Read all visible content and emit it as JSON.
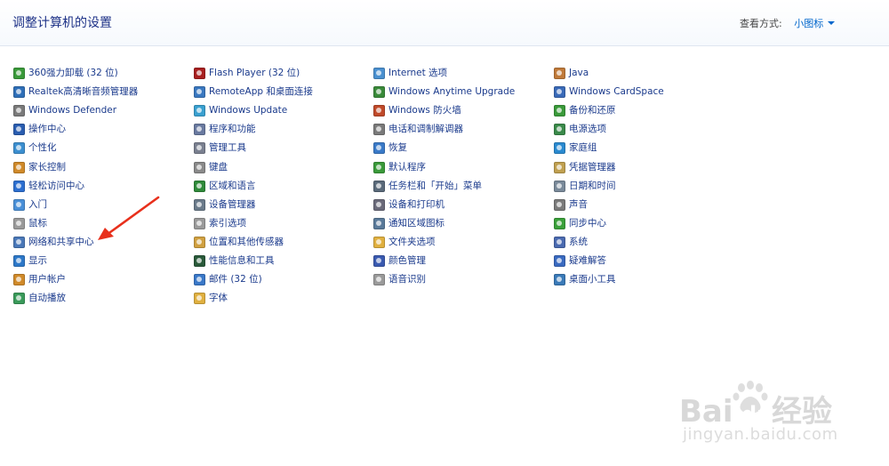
{
  "header": {
    "title": "调整计算机的设置",
    "view_by_label": "查看方式:",
    "view_by_value": "小图标"
  },
  "columns": [
    [
      {
        "label": "360强力卸载 (32 位)",
        "icon": "uninstall-icon",
        "color": "#3a9a3a"
      },
      {
        "label": "Realtek高清晰音频管理器",
        "icon": "audio-manager-icon",
        "color": "#2f6fb8"
      },
      {
        "label": "Windows Defender",
        "icon": "defender-icon",
        "color": "#7a7a7a"
      },
      {
        "label": "操作中心",
        "icon": "action-center-flag-icon",
        "color": "#2a5db0"
      },
      {
        "label": "个性化",
        "icon": "personalization-icon",
        "color": "#3c8fd0"
      },
      {
        "label": "家长控制",
        "icon": "parental-controls-icon",
        "color": "#d08a2a"
      },
      {
        "label": "轻松访问中心",
        "icon": "ease-of-access-icon",
        "color": "#2d6fd0"
      },
      {
        "label": "入门",
        "icon": "getting-started-icon",
        "color": "#4a90d8"
      },
      {
        "label": "鼠标",
        "icon": "mouse-icon",
        "color": "#9a9a9a"
      },
      {
        "label": "网络和共享中心",
        "icon": "network-sharing-icon",
        "color": "#4a78b8"
      },
      {
        "label": "显示",
        "icon": "display-icon",
        "color": "#2d78c8"
      },
      {
        "label": "用户帐户",
        "icon": "user-accounts-icon",
        "color": "#d08a2a"
      },
      {
        "label": "自动播放",
        "icon": "autoplay-icon",
        "color": "#3a9a5a"
      }
    ],
    [
      {
        "label": "Flash Player (32 位)",
        "icon": "flash-player-icon",
        "color": "#a82020"
      },
      {
        "label": "RemoteApp 和桌面连接",
        "icon": "remoteapp-icon",
        "color": "#3a78c0"
      },
      {
        "label": "Windows Update",
        "icon": "windows-update-icon",
        "color": "#3aa0d0"
      },
      {
        "label": "程序和功能",
        "icon": "programs-features-icon",
        "color": "#6a7aa0"
      },
      {
        "label": "管理工具",
        "icon": "admin-tools-icon",
        "color": "#7a8090"
      },
      {
        "label": "键盘",
        "icon": "keyboard-icon",
        "color": "#8a8a8a"
      },
      {
        "label": "区域和语言",
        "icon": "region-language-icon",
        "color": "#2f8a3a"
      },
      {
        "label": "设备管理器",
        "icon": "device-manager-icon",
        "color": "#6a7a8a"
      },
      {
        "label": "索引选项",
        "icon": "indexing-options-icon",
        "color": "#9a9a9a"
      },
      {
        "label": "位置和其他传感器",
        "icon": "location-sensors-icon",
        "color": "#d0a040"
      },
      {
        "label": "性能信息和工具",
        "icon": "performance-icon",
        "color": "#2a5a3a"
      },
      {
        "label": "邮件 (32 位)",
        "icon": "mail-icon",
        "color": "#3a78c8"
      },
      {
        "label": "字体",
        "icon": "fonts-folder-icon",
        "color": "#e0b040"
      }
    ],
    [
      {
        "label": "Internet 选项",
        "icon": "internet-options-icon",
        "color": "#4a90d0"
      },
      {
        "label": "Windows Anytime Upgrade",
        "icon": "anytime-upgrade-icon",
        "color": "#3a8a3a"
      },
      {
        "label": "Windows 防火墙",
        "icon": "firewall-icon",
        "color": "#c04a2a"
      },
      {
        "label": "电话和调制解调器",
        "icon": "phone-modem-icon",
        "color": "#7a7a7a"
      },
      {
        "label": "恢复",
        "icon": "recovery-icon",
        "color": "#3a7ac8"
      },
      {
        "label": "默认程序",
        "icon": "default-programs-icon",
        "color": "#3a9a3a"
      },
      {
        "label": "任务栏和「开始」菜单",
        "icon": "taskbar-start-icon",
        "color": "#5a6a7a"
      },
      {
        "label": "设备和打印机",
        "icon": "devices-printers-icon",
        "color": "#6a6a7a"
      },
      {
        "label": "通知区域图标",
        "icon": "notification-area-icon",
        "color": "#5a7a9a"
      },
      {
        "label": "文件夹选项",
        "icon": "folder-options-icon",
        "color": "#e0b040"
      },
      {
        "label": "颜色管理",
        "icon": "color-management-icon",
        "color": "#3a5ab0"
      },
      {
        "label": "语音识别",
        "icon": "speech-recognition-icon",
        "color": "#9a9a9a"
      }
    ],
    [
      {
        "label": "Java",
        "icon": "java-icon",
        "color": "#c07a3a"
      },
      {
        "label": "Windows CardSpace",
        "icon": "cardspace-icon",
        "color": "#3a6ab8"
      },
      {
        "label": "备份和还原",
        "icon": "backup-restore-icon",
        "color": "#3a9a3a"
      },
      {
        "label": "电源选项",
        "icon": "power-options-icon",
        "color": "#3a8a4a"
      },
      {
        "label": "家庭组",
        "icon": "homegroup-icon",
        "color": "#2a8ad0"
      },
      {
        "label": "凭据管理器",
        "icon": "credential-manager-icon",
        "color": "#c0a050"
      },
      {
        "label": "日期和时间",
        "icon": "date-time-icon",
        "color": "#7a8a9a"
      },
      {
        "label": "声音",
        "icon": "sound-icon",
        "color": "#7a7a7a"
      },
      {
        "label": "同步中心",
        "icon": "sync-center-icon",
        "color": "#3aa03a"
      },
      {
        "label": "系统",
        "icon": "system-icon",
        "color": "#4a6ab0"
      },
      {
        "label": "疑难解答",
        "icon": "troubleshooting-icon",
        "color": "#3a6ac0"
      },
      {
        "label": "桌面小工具",
        "icon": "desktop-gadgets-icon",
        "color": "#3a7ab8"
      }
    ]
  ],
  "annotation": {
    "arrow_color": "#e8301c",
    "arrow_target": "网络和共享中心"
  },
  "watermark": {
    "logo_text": "Bai",
    "logo_text_2": "du",
    "logo_text_3": "经验",
    "url": "jingyan.baidu.com",
    "color": "#d8d8d8"
  }
}
